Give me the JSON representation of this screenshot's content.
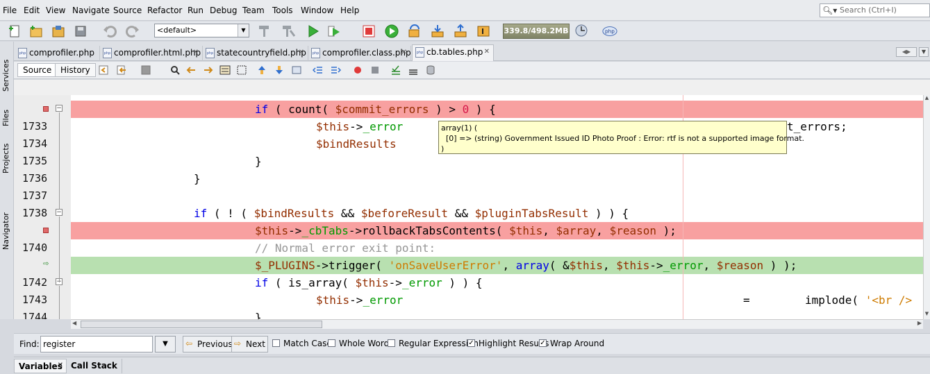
{
  "menu": [
    "File",
    "Edit",
    "View",
    "Navigate",
    "Source",
    "Refactor",
    "Run",
    "Debug",
    "Team",
    "Tools",
    "Window",
    "Help"
  ],
  "search": {
    "placeholder": "Search (Ctrl+I)"
  },
  "toolbar": {
    "config": "<default>",
    "memory": "339.8/498.2MB",
    "php_badge": "php"
  },
  "side_labels": [
    "Services",
    "Files",
    "Projects",
    "Navigator"
  ],
  "tabs": [
    {
      "label": "comprofiler.php"
    },
    {
      "label": "comprofiler.html.php"
    },
    {
      "label": "statecountryfield.php"
    },
    {
      "label": "comprofiler.class.php"
    },
    {
      "label": "cb.tables.php"
    }
  ],
  "editor_tabs": {
    "source": "Source",
    "history": "History"
  },
  "lines": [
    {
      "num": "1733"
    },
    {
      "num": "1734"
    },
    {
      "num": "1735"
    },
    {
      "num": "1736"
    },
    {
      "num": "1737"
    },
    {
      "num": "1738"
    },
    {
      "num": "1740"
    },
    {
      "num": "1742"
    },
    {
      "num": "1743"
    },
    {
      "num": "1744"
    }
  ],
  "code": {
    "l1": [
      "if",
      " ( ",
      "count",
      "( ",
      "$commit_errors",
      " ) > ",
      "0",
      " ) {"
    ],
    "l2": [
      "$this",
      "->",
      "_error",
      "t_errors;"
    ],
    "l3": [
      "$bindResults"
    ],
    "l4": [
      "}"
    ],
    "l5": [
      "}"
    ],
    "l7": [
      "if",
      " ( ! ( ",
      "$bindResults",
      " && ",
      "$beforeResult",
      " && ",
      "$pluginTabsResult",
      " ) ) {"
    ],
    "l8": [
      "$this",
      "->",
      "_cbTabs",
      "->rollbackTabsContents( ",
      "$this",
      ", ",
      "$array",
      ", ",
      "$reason",
      " );"
    ],
    "l9": [
      "// Normal error exit point:"
    ],
    "l10": [
      "$_PLUGINS",
      "->trigger( ",
      "'onSaveUserError'",
      ", ",
      "array",
      "( &",
      "$this",
      ", ",
      "$this",
      "->",
      "_error",
      ", ",
      "$reason",
      " ) );"
    ],
    "l11": [
      "if",
      " ( is_array( ",
      "$this",
      "->",
      "_error",
      " ) ) {"
    ],
    "l12": [
      "$this",
      "->",
      "_error",
      "=",
      "implode( ",
      "'<br />"
    ],
    "l13": [
      "}"
    ]
  },
  "tooltip": {
    "line1": "array(1) (",
    "line2": "  [0] => (string) Government Issued ID Photo Proof : Error: rtf is not a supported image format.",
    "line3": ")"
  },
  "find": {
    "label": "Find:",
    "value": "register",
    "previous": "Previous",
    "next": "Next",
    "options": [
      {
        "label": "Match Case",
        "checked": false
      },
      {
        "label": "Whole Words",
        "checked": false
      },
      {
        "label": "Regular Expression",
        "checked": false
      },
      {
        "label": "Highlight Results",
        "checked": true
      },
      {
        "label": "Wrap Around",
        "checked": true
      }
    ]
  },
  "bottom_tabs": {
    "variables": "Variables",
    "call_stack": "Call Stack"
  },
  "colors": {
    "breakpoint_line": "#f8a0a0",
    "current_line": "#b8e0b0",
    "keyword": "#0000e6",
    "variable": "#932e00",
    "string": "#ce7b00"
  }
}
